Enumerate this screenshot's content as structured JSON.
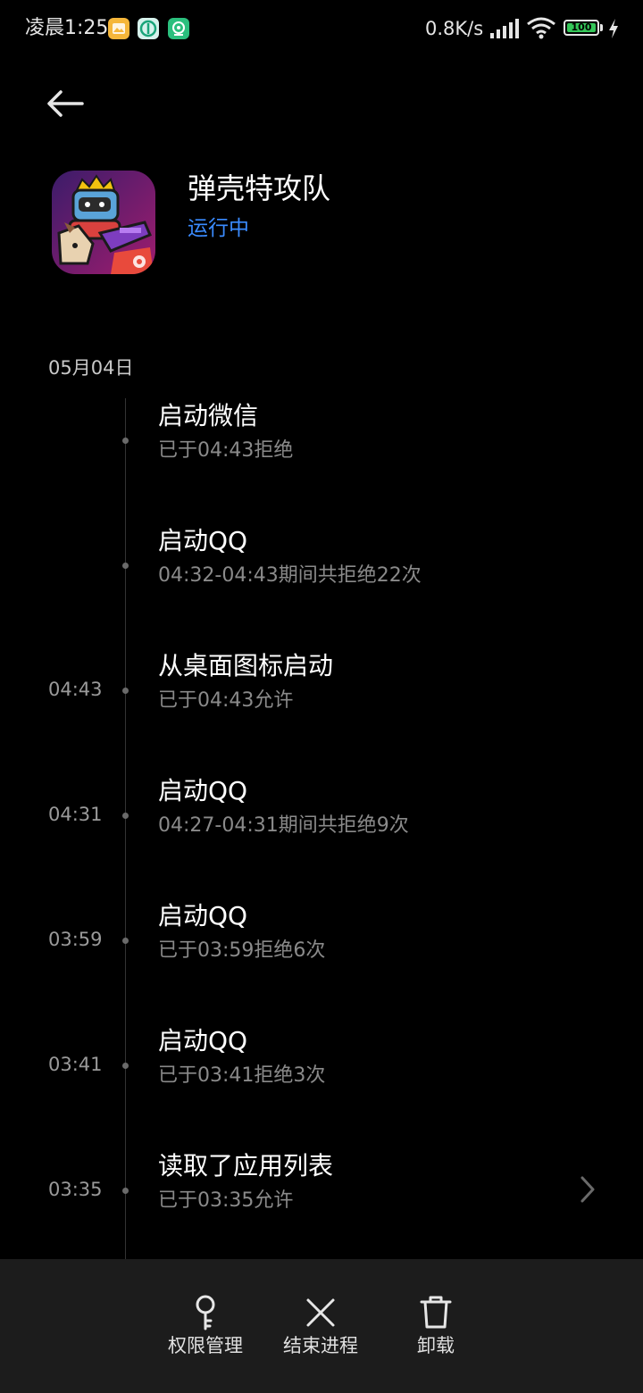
{
  "status_bar": {
    "time": "凌晨1:25",
    "network_speed": "0.8K/s",
    "battery_level": "100",
    "battery_color": "#35c759",
    "app_icons": [
      "gallery-icon",
      "security-shield-icon",
      "antivirus-icon"
    ]
  },
  "app": {
    "name": "弹壳特攻队",
    "status": "运行中",
    "status_color": "#3a8bff",
    "icon_name": "game-app-icon"
  },
  "timeline": {
    "date": "05月04日",
    "entries": [
      {
        "time": "",
        "title": "启动微信",
        "subtitle": "已于04:43拒绝"
      },
      {
        "time": "",
        "title": "启动QQ",
        "subtitle": "04:32-04:43期间共拒绝22次"
      },
      {
        "time": "04:43",
        "title": "从桌面图标启动",
        "subtitle": "已于04:43允许"
      },
      {
        "time": "04:31",
        "title": "启动QQ",
        "subtitle": "04:27-04:31期间共拒绝9次"
      },
      {
        "time": "03:59",
        "title": "启动QQ",
        "subtitle": "已于03:59拒绝6次"
      },
      {
        "time": "03:41",
        "title": "启动QQ",
        "subtitle": "已于03:41拒绝3次"
      },
      {
        "time": "03:35",
        "title": "读取了应用列表",
        "subtitle": "已于03:35允许"
      }
    ]
  },
  "bottom_bar": {
    "permissions_label": "权限管理",
    "end_process_label": "结束进程",
    "uninstall_label": "卸载"
  }
}
